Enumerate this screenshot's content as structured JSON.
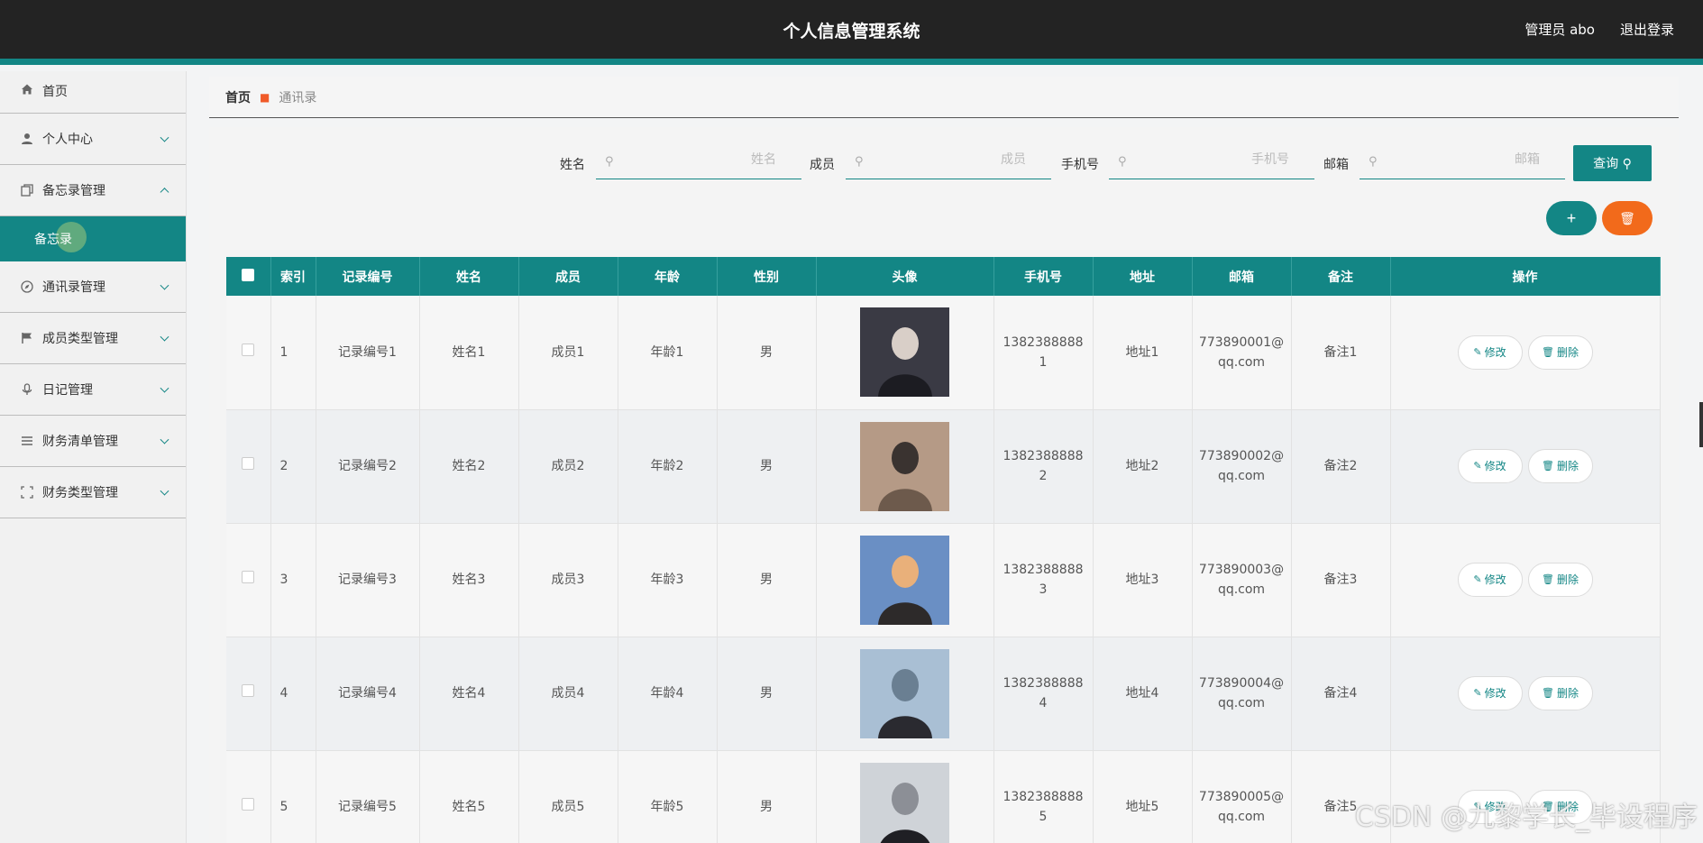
{
  "header": {
    "title": "个人信息管理系统",
    "admin": "管理员 abo",
    "logout": "退出登录"
  },
  "sidebar": {
    "home": "首页",
    "items": [
      {
        "label": "个人中心",
        "icon": "user-icon"
      },
      {
        "label": "备忘录管理",
        "icon": "copy-icon",
        "expanded": true
      },
      {
        "label": "通讯录管理",
        "icon": "compass-icon"
      },
      {
        "label": "成员类型管理",
        "icon": "flag-icon"
      },
      {
        "label": "日记管理",
        "icon": "mic-icon"
      },
      {
        "label": "财务清单管理",
        "icon": "list-icon"
      },
      {
        "label": "财务类型管理",
        "icon": "fullscreen-icon"
      }
    ],
    "active_sub": "备忘录"
  },
  "breadcrumb": {
    "home": "首页",
    "current": "通讯录"
  },
  "search": {
    "name_label": "姓名",
    "name_placeholder": "姓名",
    "member_label": "成员",
    "member_placeholder": "成员",
    "phone_label": "手机号",
    "phone_placeholder": "手机号",
    "email_label": "邮箱",
    "email_placeholder": "邮箱",
    "query_label": "查询 ⚲"
  },
  "actions": {
    "add": "+",
    "delete": "🗑"
  },
  "table": {
    "headers": [
      "",
      "索引",
      "记录编号",
      "姓名",
      "成员",
      "年龄",
      "性别",
      "头像",
      "手机号",
      "地址",
      "邮箱",
      "备注",
      "操作"
    ],
    "edit_label": "修改",
    "delete_label": "删除",
    "rows": [
      {
        "index": "1",
        "record": "记录编号1",
        "name": "姓名1",
        "member": "成员1",
        "age": "年龄1",
        "gender": "男",
        "phone1": "1382388888",
        "phone2": "1",
        "address": "地址1",
        "email1": "773890001@",
        "email2": "qq.com",
        "note": "备注1"
      },
      {
        "index": "2",
        "record": "记录编号2",
        "name": "姓名2",
        "member": "成员2",
        "age": "年龄2",
        "gender": "男",
        "phone1": "1382388888",
        "phone2": "2",
        "address": "地址2",
        "email1": "773890002@",
        "email2": "qq.com",
        "note": "备注2"
      },
      {
        "index": "3",
        "record": "记录编号3",
        "name": "姓名3",
        "member": "成员3",
        "age": "年龄3",
        "gender": "男",
        "phone1": "1382388888",
        "phone2": "3",
        "address": "地址3",
        "email1": "773890003@",
        "email2": "qq.com",
        "note": "备注3"
      },
      {
        "index": "4",
        "record": "记录编号4",
        "name": "姓名4",
        "member": "成员4",
        "age": "年龄4",
        "gender": "男",
        "phone1": "1382388888",
        "phone2": "4",
        "address": "地址4",
        "email1": "773890004@",
        "email2": "qq.com",
        "note": "备注4"
      },
      {
        "index": "5",
        "record": "记录编号5",
        "name": "姓名5",
        "member": "成员5",
        "age": "年龄5",
        "gender": "男",
        "phone1": "1382388888",
        "phone2": "5",
        "address": "地址5",
        "email1": "773890005@",
        "email2": "qq.com",
        "note": "备注5"
      }
    ]
  },
  "watermark": "CSDN @九黎学长_毕设程序",
  "colors": {
    "accent": "#138685",
    "danger": "#f26a1b",
    "topbar": "#232323"
  }
}
